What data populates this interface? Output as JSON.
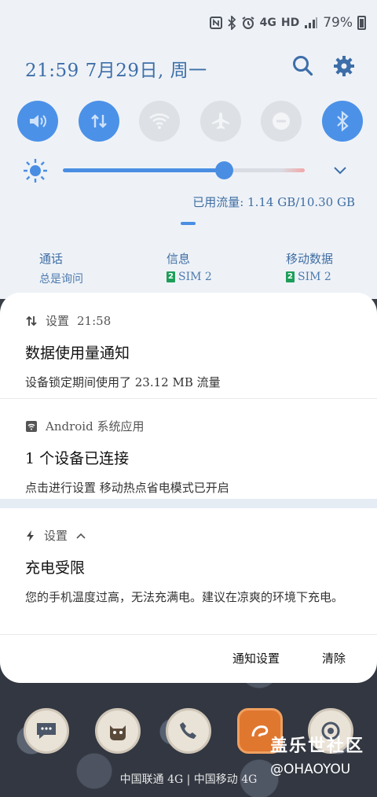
{
  "status_bar": {
    "indicators": [
      "nfc-icon",
      "bluetooth-icon",
      "alarm-icon",
      "4g-icon",
      "hd-icon",
      "signal-icon"
    ],
    "net_label": "4G",
    "hd_label": "HD",
    "battery": "79%"
  },
  "header": {
    "datetime": "21:59  7月29日, 周一"
  },
  "quick_settings": [
    {
      "name": "sound",
      "on": true
    },
    {
      "name": "mobile-data",
      "on": true
    },
    {
      "name": "wifi",
      "on": false
    },
    {
      "name": "airplane",
      "on": false
    },
    {
      "name": "dnd",
      "on": false
    },
    {
      "name": "bluetooth",
      "on": true
    }
  ],
  "brightness": {
    "level": 0.67
  },
  "data_usage": "已用流量: 1.14 GB/10.30 GB",
  "sim_panel": [
    {
      "title": "通话",
      "sub": "总是询问",
      "badge": ""
    },
    {
      "title": "信息",
      "sub": "SIM 2",
      "badge": "2"
    },
    {
      "title": "移动数据",
      "sub": "SIM 2",
      "badge": "2"
    }
  ],
  "notifications": [
    {
      "app": "设置",
      "time": "21:58",
      "title": "数据使用量通知",
      "body": "设备锁定期间使用了 23.12 MB 流量"
    },
    {
      "app": "Android 系统应用",
      "title": "1 个设备已连接",
      "body": "点击进行设置 移动热点省电模式已开启"
    },
    {
      "app": "设置",
      "title": "充电受限",
      "body": "您的手机温度过高，无法充满电。建议在凉爽的环境下充电。"
    }
  ],
  "actions": {
    "settings": "通知设置",
    "clear": "清除"
  },
  "watermark": {
    "title": "盖乐世社区",
    "sub": "@OHAOYOU"
  },
  "carrier": "中国联通 4G | 中国移动 4G",
  "colors": {
    "accent": "#4b91e8",
    "text_blue": "#3d6ea8"
  }
}
